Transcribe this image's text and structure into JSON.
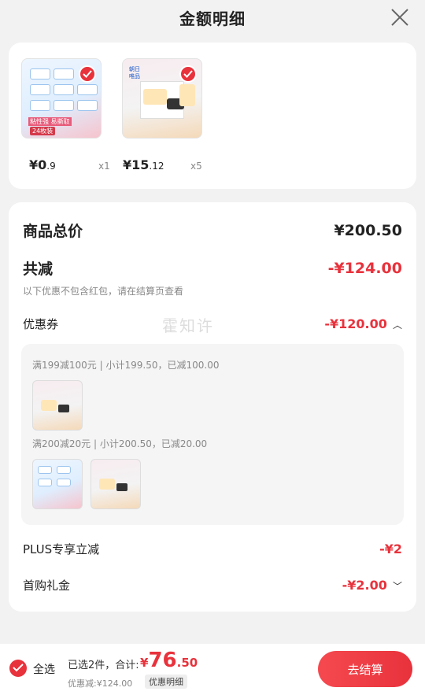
{
  "header": {
    "title": "金额明细"
  },
  "products": [
    {
      "price_int": "¥0",
      "price_dec": ".9",
      "qty": "x1",
      "thumb_text_1": "粘性强 易撕取",
      "thumb_text_2": "24枚装"
    },
    {
      "price_int": "¥15",
      "price_dec": ".12",
      "qty": "x5",
      "thumb_text_1": "朝日",
      "thumb_text_2": "唯品"
    }
  ],
  "detail": {
    "total_label": "商品总价",
    "total_value": "¥200.50",
    "reduce_label": "共减",
    "reduce_value": "-¥124.00",
    "note": "以下优惠不包含红包，请在结算页查看",
    "coupon_label": "优惠券",
    "coupon_value": "-¥120.00",
    "coupon_lines": [
      "满199减100元 | 小计199.50，已减100.00",
      "满200减20元 | 小计200.50，已减20.00"
    ],
    "plus_label": "PLUS专享立减",
    "plus_value": "-¥2",
    "first_label": "首购礼金",
    "first_value": "-¥2.00"
  },
  "watermark": "霍知许",
  "bottom": {
    "select_all": "全选",
    "summary": "已选2件，合计:",
    "total_sym": "¥",
    "total_int": "76",
    "total_dec": ".50",
    "discount": "优惠减:¥124.00",
    "discount_detail": "优惠明细",
    "checkout": "去结算"
  },
  "colors": {
    "accent": "#e8323c",
    "background": "#f2f2f2"
  }
}
